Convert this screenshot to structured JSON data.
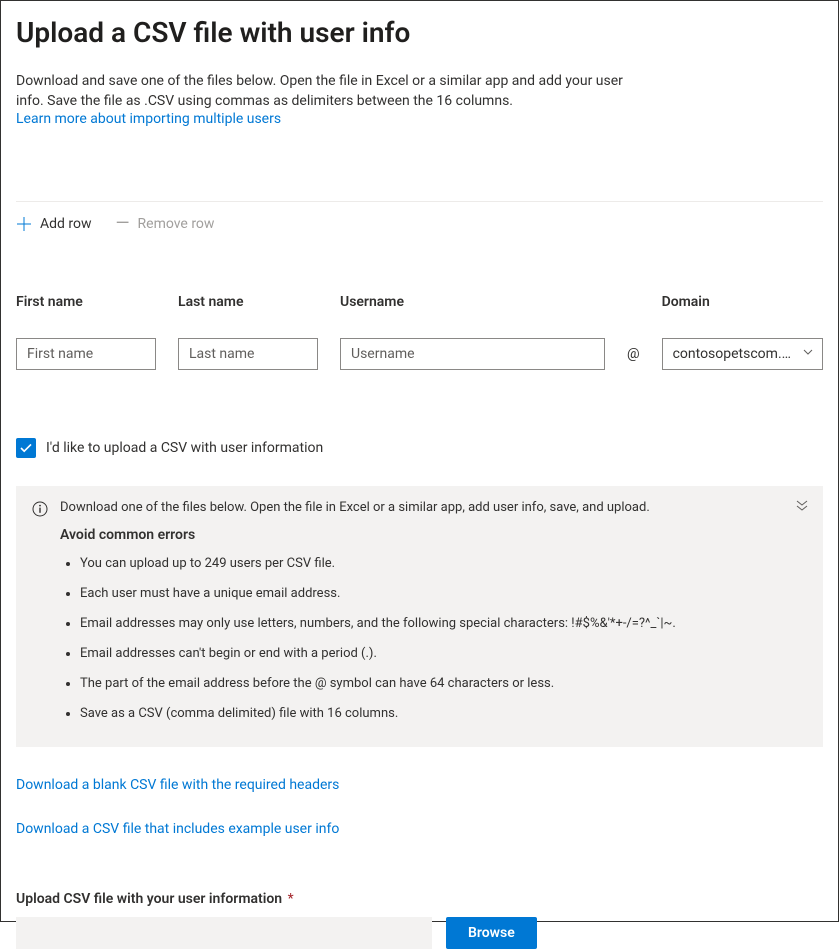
{
  "header": {
    "title": "Upload a CSV file with user info",
    "intro": "Download and save one of the files below. Open the file in Excel or a similar app and add your user info. Save the file as .CSV using commas as delimiters between the 16 columns.",
    "learn_more": "Learn more about importing multiple users"
  },
  "toolbar": {
    "add_row": "Add row",
    "remove_row": "Remove row"
  },
  "form": {
    "first_name": {
      "label": "First name",
      "placeholder": "First name",
      "value": ""
    },
    "last_name": {
      "label": "Last name",
      "placeholder": "Last name",
      "value": ""
    },
    "username": {
      "label": "Username",
      "placeholder": "Username",
      "value": ""
    },
    "at": "@",
    "domain": {
      "label": "Domain",
      "selected": "contosopetscom.onmic..."
    }
  },
  "checkbox": {
    "label": "I'd like to upload a CSV with user information",
    "checked": true
  },
  "info_panel": {
    "lead": "Download one of the files below. Open the file in Excel or a similar app, add user info, save, and upload.",
    "subtitle": "Avoid common errors",
    "items": [
      "You can upload up to 249 users per CSV file.",
      "Each user must have a unique email address.",
      "Email addresses may only use letters, numbers, and the following special characters: !#$%&'*+-/=?^_`|~.",
      "Email addresses can't begin or end with a period (.).",
      "The part of the email address before the @ symbol can have 64 characters or less.",
      "Save as a CSV (comma delimited) file with 16 columns."
    ]
  },
  "downloads": {
    "blank": "Download a blank CSV file with the required headers",
    "example": "Download a CSV file that includes example user info"
  },
  "upload": {
    "label": "Upload CSV file with your user information",
    "required_marker": "*",
    "browse": "Browse",
    "file_value": ""
  }
}
